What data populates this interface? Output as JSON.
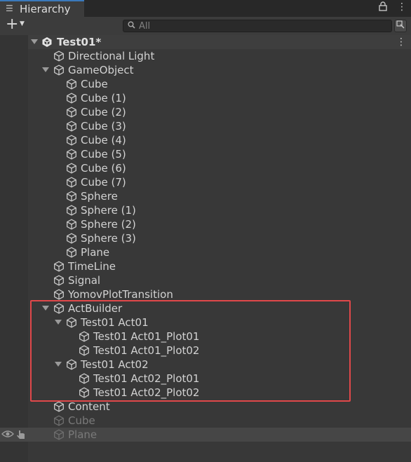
{
  "window": {
    "tab_label": "Hierarchy",
    "tab_icon": "list-icon",
    "lock_icon": "lock-icon",
    "menu_icon": "kebab-menu-icon"
  },
  "toolbar": {
    "add_icon": "plus-icon",
    "dropdown_icon": "caret-down-icon",
    "search_placeholder": "All",
    "search_icon": "search-icon",
    "scene_visibility_icon": "scene-view-icon"
  },
  "scene": {
    "name": "Test01*",
    "icon": "unity-logo-icon",
    "menu_icon": "kebab-menu-icon"
  },
  "hierarchy": [
    {
      "label": "Directional Light",
      "depth": 0,
      "expanded": null,
      "enabled": true
    },
    {
      "label": "GameObject",
      "depth": 0,
      "expanded": true,
      "enabled": true
    },
    {
      "label": "Cube",
      "depth": 1,
      "expanded": null,
      "enabled": true
    },
    {
      "label": "Cube (1)",
      "depth": 1,
      "expanded": null,
      "enabled": true
    },
    {
      "label": "Cube (2)",
      "depth": 1,
      "expanded": null,
      "enabled": true
    },
    {
      "label": "Cube (3)",
      "depth": 1,
      "expanded": null,
      "enabled": true
    },
    {
      "label": "Cube (4)",
      "depth": 1,
      "expanded": null,
      "enabled": true
    },
    {
      "label": "Cube (5)",
      "depth": 1,
      "expanded": null,
      "enabled": true
    },
    {
      "label": "Cube (6)",
      "depth": 1,
      "expanded": null,
      "enabled": true
    },
    {
      "label": "Cube (7)",
      "depth": 1,
      "expanded": null,
      "enabled": true
    },
    {
      "label": "Sphere",
      "depth": 1,
      "expanded": null,
      "enabled": true
    },
    {
      "label": "Sphere (1)",
      "depth": 1,
      "expanded": null,
      "enabled": true
    },
    {
      "label": "Sphere (2)",
      "depth": 1,
      "expanded": null,
      "enabled": true
    },
    {
      "label": "Sphere (3)",
      "depth": 1,
      "expanded": null,
      "enabled": true
    },
    {
      "label": "Plane",
      "depth": 1,
      "expanded": null,
      "enabled": true
    },
    {
      "label": "TimeLine",
      "depth": 0,
      "expanded": null,
      "enabled": true
    },
    {
      "label": "Signal",
      "depth": 0,
      "expanded": null,
      "enabled": true
    },
    {
      "label": "YomovPlotTransition",
      "depth": 0,
      "expanded": null,
      "enabled": true
    },
    {
      "label": "ActBuilder",
      "depth": 0,
      "expanded": true,
      "enabled": true
    },
    {
      "label": "Test01 Act01",
      "depth": 1,
      "expanded": true,
      "enabled": true
    },
    {
      "label": "Test01 Act01_Plot01",
      "depth": 2,
      "expanded": null,
      "enabled": true
    },
    {
      "label": "Test01 Act01_Plot02",
      "depth": 2,
      "expanded": null,
      "enabled": true
    },
    {
      "label": "Test01 Act02",
      "depth": 1,
      "expanded": true,
      "enabled": true
    },
    {
      "label": "Test01 Act02_Plot01",
      "depth": 2,
      "expanded": null,
      "enabled": true
    },
    {
      "label": "Test01 Act02_Plot02",
      "depth": 2,
      "expanded": null,
      "enabled": true
    },
    {
      "label": "Content",
      "depth": 0,
      "expanded": null,
      "enabled": true
    },
    {
      "label": "Cube",
      "depth": 0,
      "expanded": null,
      "enabled": false
    },
    {
      "label": "Plane",
      "depth": 0,
      "expanded": null,
      "enabled": false,
      "hovered": true
    }
  ],
  "row_icons": {
    "gameobject": "cube-icon",
    "visibility": "eye-icon",
    "pickability": "hand-pointer-icon"
  },
  "colors": {
    "background": "#383838",
    "highlight_border": "#e0484a",
    "tab_accent": "#3a79bb"
  }
}
